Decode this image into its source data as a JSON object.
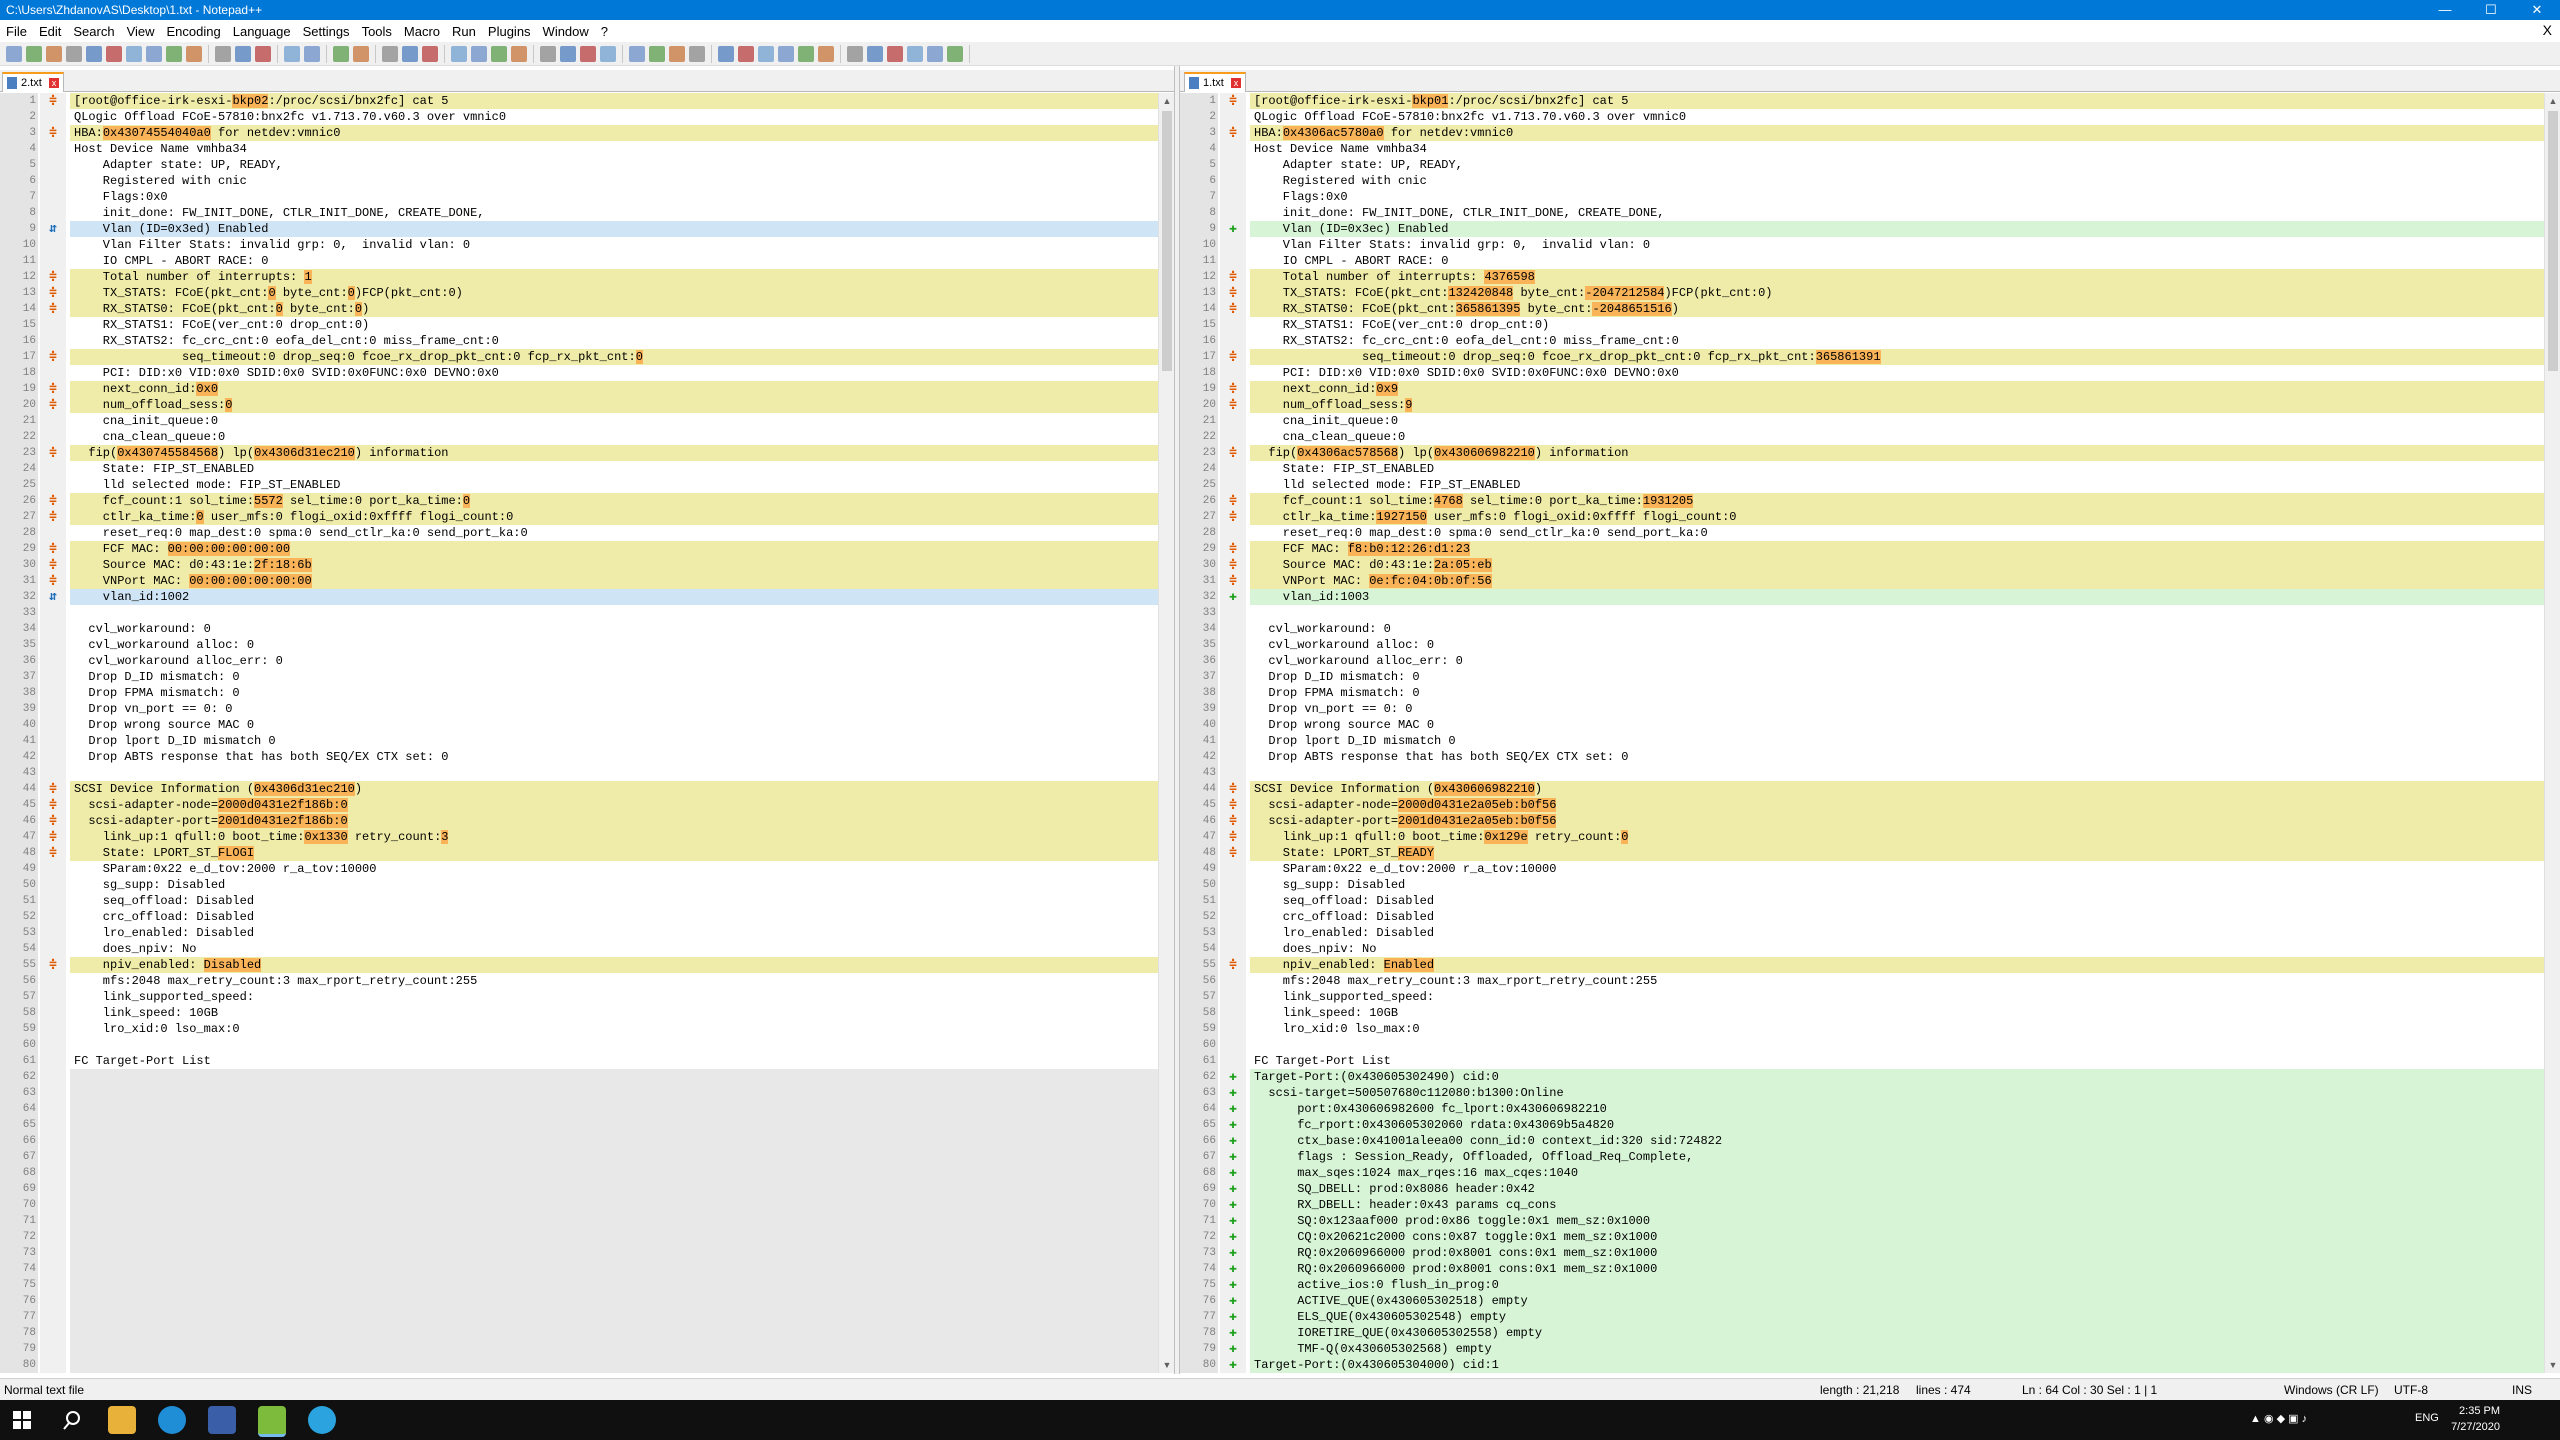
{
  "window": {
    "title": "C:\\Users\\ZhdanovAS\\Desktop\\1.txt - Notepad++",
    "minimize": "—",
    "maximize": "☐",
    "close": "✕"
  },
  "menu": [
    "File",
    "Edit",
    "Search",
    "View",
    "Encoding",
    "Language",
    "Settings",
    "Tools",
    "Macro",
    "Run",
    "Plugins",
    "Window",
    "?"
  ],
  "menu_close": "X",
  "left": {
    "tab": "2.txt",
    "lines": [
      {
        "n": 1,
        "m": "changed",
        "t": "[root@office-irk-esxi-<h>bkp02</h>:/proc/scsi/bnx2fc] cat 5"
      },
      {
        "n": 2,
        "m": "",
        "t": "QLogic Offload FCoE-57810:bnx2fc v1.713.70.v60.3 over vmnic0"
      },
      {
        "n": 3,
        "m": "changed",
        "t": "HBA:<h>0x43074554040a0</h> for netdev:vmnic0"
      },
      {
        "n": 4,
        "m": "",
        "t": "Host Device Name vmhba34"
      },
      {
        "n": 5,
        "m": "",
        "t": "    Adapter state: UP, READY,"
      },
      {
        "n": 6,
        "m": "",
        "t": "    Registered with cnic"
      },
      {
        "n": 7,
        "m": "",
        "t": "    Flags:0x0"
      },
      {
        "n": 8,
        "m": "",
        "t": "    init_done: FW_INIT_DONE, CTLR_INIT_DONE, CREATE_DONE,"
      },
      {
        "n": 9,
        "m": "moved",
        "t": "    Vlan (ID=0x3ed) Enabled"
      },
      {
        "n": 10,
        "m": "",
        "t": "    Vlan Filter Stats: invalid grp: 0,  invalid vlan: 0"
      },
      {
        "n": 11,
        "m": "",
        "t": "    IO CMPL - ABORT RACE: 0"
      },
      {
        "n": 12,
        "m": "changed",
        "t": "    Total number of interrupts: <h>1</h>"
      },
      {
        "n": 13,
        "m": "changed",
        "t": "    TX_STATS: FCoE(pkt_cnt:<h>0</h> byte_cnt:<h>0</h>)FCP(pkt_cnt:0)"
      },
      {
        "n": 14,
        "m": "changed",
        "t": "    RX_STATS0: FCoE(pkt_cnt:<h>0</h> byte_cnt:<h>0</h>)"
      },
      {
        "n": 15,
        "m": "",
        "t": "    RX_STATS1: FCoE(ver_cnt:0 drop_cnt:0)"
      },
      {
        "n": 16,
        "m": "",
        "t": "    RX_STATS2: fc_crc_cnt:0 eofa_del_cnt:0 miss_frame_cnt:0"
      },
      {
        "n": 17,
        "m": "changed",
        "t": "               seq_timeout:0 drop_seq:0 fcoe_rx_drop_pkt_cnt:0 fcp_rx_pkt_cnt:<h>0</h>"
      },
      {
        "n": 18,
        "m": "",
        "t": "    PCI: DID:x0 VID:0x0 SDID:0x0 SVID:0x0FUNC:0x0 DEVNO:0x0"
      },
      {
        "n": 19,
        "m": "changed",
        "t": "    next_conn_id:<h>0x0</h>"
      },
      {
        "n": 20,
        "m": "changed",
        "t": "    num_offload_sess:<h>0</h>"
      },
      {
        "n": 21,
        "m": "",
        "t": "    cna_init_queue:0"
      },
      {
        "n": 22,
        "m": "",
        "t": "    cna_clean_queue:0"
      },
      {
        "n": 23,
        "m": "changed",
        "t": "  fip(<h>0x430745584568</h>) lp(<h>0x4306d31ec210</h>) information"
      },
      {
        "n": 24,
        "m": "",
        "t": "    State: FIP_ST_ENABLED"
      },
      {
        "n": 25,
        "m": "",
        "t": "    lld selected mode: FIP_ST_ENABLED"
      },
      {
        "n": 26,
        "m": "changed",
        "t": "    fcf_count:1 sol_time:<h>5572</h> sel_time:0 port_ka_time:<h>0</h>"
      },
      {
        "n": 27,
        "m": "changed",
        "t": "    ctlr_ka_time:<h>0</h> user_mfs:0 flogi_oxid:0xffff flogi_count:0"
      },
      {
        "n": 28,
        "m": "",
        "t": "    reset_req:0 map_dest:0 spma:0 send_ctlr_ka:0 send_port_ka:0"
      },
      {
        "n": 29,
        "m": "changed",
        "t": "    FCF MAC: <h>00:00:00:00:00:00</h>"
      },
      {
        "n": 30,
        "m": "changed",
        "t": "    Source MAC: d0:43:1e:<h>2f:18:6b</h>"
      },
      {
        "n": 31,
        "m": "changed",
        "t": "    VNPort MAC: <h>00:00:00:00:00:00</h>"
      },
      {
        "n": 32,
        "m": "moved",
        "t": "    vlan_id:1002"
      },
      {
        "n": 33,
        "m": "",
        "t": ""
      },
      {
        "n": 34,
        "m": "",
        "t": "  cvl_workaround: 0"
      },
      {
        "n": 35,
        "m": "",
        "t": "  cvl_workaround alloc: 0"
      },
      {
        "n": 36,
        "m": "",
        "t": "  cvl_workaround alloc_err: 0"
      },
      {
        "n": 37,
        "m": "",
        "t": "  Drop D_ID mismatch: 0"
      },
      {
        "n": 38,
        "m": "",
        "t": "  Drop FPMA mismatch: 0"
      },
      {
        "n": 39,
        "m": "",
        "t": "  Drop vn_port == 0: 0"
      },
      {
        "n": 40,
        "m": "",
        "t": "  Drop wrong source MAC 0"
      },
      {
        "n": 41,
        "m": "",
        "t": "  Drop lport D_ID mismatch 0"
      },
      {
        "n": 42,
        "m": "",
        "t": "  Drop ABTS response that has both SEQ/EX CTX set: 0"
      },
      {
        "n": 43,
        "m": "",
        "t": ""
      },
      {
        "n": 44,
        "m": "changed",
        "t": "SCSI Device Information (<h>0x4306d31ec210</h>)"
      },
      {
        "n": 45,
        "m": "changed",
        "t": "  scsi-adapter-node=<h>2000d0431e2f186b:0</h>"
      },
      {
        "n": 46,
        "m": "changed",
        "t": "  scsi-adapter-port=<h>2001d0431e2f186b:0</h>"
      },
      {
        "n": 47,
        "m": "changed",
        "t": "    link_up:1 qfull:0 boot_time:<h>0x1330</h> retry_count:<h>3</h>"
      },
      {
        "n": 48,
        "m": "changed",
        "t": "    State: LPORT_ST_<h>FLOGI</h>"
      },
      {
        "n": 49,
        "m": "",
        "t": "    SParam:0x22 e_d_tov:2000 r_a_tov:10000"
      },
      {
        "n": 50,
        "m": "",
        "t": "    sg_supp: Disabled"
      },
      {
        "n": 51,
        "m": "",
        "t": "    seq_offload: Disabled"
      },
      {
        "n": 52,
        "m": "",
        "t": "    crc_offload: Disabled"
      },
      {
        "n": 53,
        "m": "",
        "t": "    lro_enabled: Disabled"
      },
      {
        "n": 54,
        "m": "",
        "t": "    does_npiv: No"
      },
      {
        "n": 55,
        "m": "changed",
        "t": "    npiv_enabled: <h>Disabled</h>"
      },
      {
        "n": 56,
        "m": "",
        "t": "    mfs:2048 max_retry_count:3 max_rport_retry_count:255"
      },
      {
        "n": 57,
        "m": "",
        "t": "    link_supported_speed:"
      },
      {
        "n": 58,
        "m": "",
        "t": "    link_speed: 10GB"
      },
      {
        "n": 59,
        "m": "",
        "t": "    lro_xid:0 lso_max:0"
      },
      {
        "n": 60,
        "m": "",
        "t": ""
      },
      {
        "n": 61,
        "m": "",
        "t": "FC Target-Port List"
      },
      {
        "n": 62,
        "m": "blank",
        "t": ""
      },
      {
        "n": 63,
        "m": "blank",
        "t": ""
      },
      {
        "n": 64,
        "m": "blank",
        "t": ""
      },
      {
        "n": 65,
        "m": "blank",
        "t": ""
      },
      {
        "n": 66,
        "m": "blank",
        "t": ""
      },
      {
        "n": 67,
        "m": "blank",
        "t": ""
      },
      {
        "n": 68,
        "m": "blank",
        "t": ""
      },
      {
        "n": 69,
        "m": "blank",
        "t": ""
      },
      {
        "n": 70,
        "m": "blank",
        "t": ""
      },
      {
        "n": 71,
        "m": "blank",
        "t": ""
      },
      {
        "n": 72,
        "m": "blank",
        "t": ""
      },
      {
        "n": 73,
        "m": "blank",
        "t": ""
      },
      {
        "n": 74,
        "m": "blank",
        "t": ""
      },
      {
        "n": 75,
        "m": "blank",
        "t": ""
      },
      {
        "n": 76,
        "m": "blank",
        "t": ""
      },
      {
        "n": 77,
        "m": "blank",
        "t": ""
      },
      {
        "n": 78,
        "m": "blank",
        "t": ""
      },
      {
        "n": 79,
        "m": "blank",
        "t": ""
      },
      {
        "n": 80,
        "m": "blank",
        "t": ""
      }
    ]
  },
  "right": {
    "tab": "1.txt",
    "lines": [
      {
        "n": 1,
        "m": "changed",
        "t": "[root@office-irk-esxi-<h>bkp01</h>:/proc/scsi/bnx2fc] cat 5"
      },
      {
        "n": 2,
        "m": "",
        "t": "QLogic Offload FCoE-57810:bnx2fc v1.713.70.v60.3 over vmnic0"
      },
      {
        "n": 3,
        "m": "changed",
        "t": "HBA:<h>0x4306ac5780a0</h> for netdev:vmnic0"
      },
      {
        "n": 4,
        "m": "",
        "t": "Host Device Name vmhba34"
      },
      {
        "n": 5,
        "m": "",
        "t": "    Adapter state: UP, READY,"
      },
      {
        "n": 6,
        "m": "",
        "t": "    Registered with cnic"
      },
      {
        "n": 7,
        "m": "",
        "t": "    Flags:0x0"
      },
      {
        "n": 8,
        "m": "",
        "t": "    init_done: FW_INIT_DONE, CTLR_INIT_DONE, CREATE_DONE,"
      },
      {
        "n": 9,
        "m": "added",
        "t": "    Vlan (ID=0x3ec) Enabled"
      },
      {
        "n": 10,
        "m": "",
        "t": "    Vlan Filter Stats: invalid grp: 0,  invalid vlan: 0"
      },
      {
        "n": 11,
        "m": "",
        "t": "    IO CMPL - ABORT RACE: 0"
      },
      {
        "n": 12,
        "m": "changed",
        "t": "    Total number of interrupts: <h>4376598</h>"
      },
      {
        "n": 13,
        "m": "changed",
        "t": "    TX_STATS: FCoE(pkt_cnt:<h>132420848</h> byte_cnt:<h>-2047212584</h>)FCP(pkt_cnt:0)"
      },
      {
        "n": 14,
        "m": "changed",
        "t": "    RX_STATS0: FCoE(pkt_cnt:<h>365861395</h> byte_cnt:<h>-2048651516</h>)"
      },
      {
        "n": 15,
        "m": "",
        "t": "    RX_STATS1: FCoE(ver_cnt:0 drop_cnt:0)"
      },
      {
        "n": 16,
        "m": "",
        "t": "    RX_STATS2: fc_crc_cnt:0 eofa_del_cnt:0 miss_frame_cnt:0"
      },
      {
        "n": 17,
        "m": "changed",
        "t": "               seq_timeout:0 drop_seq:0 fcoe_rx_drop_pkt_cnt:0 fcp_rx_pkt_cnt:<h>365861391</h>"
      },
      {
        "n": 18,
        "m": "",
        "t": "    PCI: DID:x0 VID:0x0 SDID:0x0 SVID:0x0FUNC:0x0 DEVNO:0x0"
      },
      {
        "n": 19,
        "m": "changed",
        "t": "    next_conn_id:<h>0x9</h>"
      },
      {
        "n": 20,
        "m": "changed",
        "t": "    num_offload_sess:<h>9</h>"
      },
      {
        "n": 21,
        "m": "",
        "t": "    cna_init_queue:0"
      },
      {
        "n": 22,
        "m": "",
        "t": "    cna_clean_queue:0"
      },
      {
        "n": 23,
        "m": "changed",
        "t": "  fip(<h>0x4306ac578568</h>) lp(<h>0x430606982210</h>) information"
      },
      {
        "n": 24,
        "m": "",
        "t": "    State: FIP_ST_ENABLED"
      },
      {
        "n": 25,
        "m": "",
        "t": "    lld selected mode: FIP_ST_ENABLED"
      },
      {
        "n": 26,
        "m": "changed",
        "t": "    fcf_count:1 sol_time:<h>4768</h> sel_time:0 port_ka_time:<h>1931205</h>"
      },
      {
        "n": 27,
        "m": "changed",
        "t": "    ctlr_ka_time:<h>1927150</h> user_mfs:0 flogi_oxid:0xffff flogi_count:0"
      },
      {
        "n": 28,
        "m": "",
        "t": "    reset_req:0 map_dest:0 spma:0 send_ctlr_ka:0 send_port_ka:0"
      },
      {
        "n": 29,
        "m": "changed",
        "t": "    FCF MAC: <h>f8:b0:12:26:d1:23</h>"
      },
      {
        "n": 30,
        "m": "changed",
        "t": "    Source MAC: d0:43:1e:<h>2a:05:eb</h>"
      },
      {
        "n": 31,
        "m": "changed",
        "t": "    VNPort MAC: <h>0e:fc:04:0b:0f:56</h>"
      },
      {
        "n": 32,
        "m": "added",
        "t": "    vlan_id:1003"
      },
      {
        "n": 33,
        "m": "",
        "t": ""
      },
      {
        "n": 34,
        "m": "",
        "t": "  cvl_workaround: 0"
      },
      {
        "n": 35,
        "m": "",
        "t": "  cvl_workaround alloc: 0"
      },
      {
        "n": 36,
        "m": "",
        "t": "  cvl_workaround alloc_err: 0"
      },
      {
        "n": 37,
        "m": "",
        "t": "  Drop D_ID mismatch: 0"
      },
      {
        "n": 38,
        "m": "",
        "t": "  Drop FPMA mismatch: 0"
      },
      {
        "n": 39,
        "m": "",
        "t": "  Drop vn_port == 0: 0"
      },
      {
        "n": 40,
        "m": "",
        "t": "  Drop wrong source MAC 0"
      },
      {
        "n": 41,
        "m": "",
        "t": "  Drop lport D_ID mismatch 0"
      },
      {
        "n": 42,
        "m": "",
        "t": "  Drop ABTS response that has both SEQ/EX CTX set: 0"
      },
      {
        "n": 43,
        "m": "",
        "t": ""
      },
      {
        "n": 44,
        "m": "changed",
        "t": "SCSI Device Information (<h>0x430606982210</h>)"
      },
      {
        "n": 45,
        "m": "changed",
        "t": "  scsi-adapter-node=<h>2000d0431e2a05eb:b0f56</h>"
      },
      {
        "n": 46,
        "m": "changed",
        "t": "  scsi-adapter-port=<h>2001d0431e2a05eb:b0f56</h>"
      },
      {
        "n": 47,
        "m": "changed",
        "t": "    link_up:1 qfull:0 boot_time:<h>0x129e</h> retry_count:<h>0</h>"
      },
      {
        "n": 48,
        "m": "changed",
        "t": "    State: LPORT_ST_<h>READY</h>"
      },
      {
        "n": 49,
        "m": "",
        "t": "    SParam:0x22 e_d_tov:2000 r_a_tov:10000"
      },
      {
        "n": 50,
        "m": "",
        "t": "    sg_supp: Disabled"
      },
      {
        "n": 51,
        "m": "",
        "t": "    seq_offload: Disabled"
      },
      {
        "n": 52,
        "m": "",
        "t": "    crc_offload: Disabled"
      },
      {
        "n": 53,
        "m": "",
        "t": "    lro_enabled: Disabled"
      },
      {
        "n": 54,
        "m": "",
        "t": "    does_npiv: No"
      },
      {
        "n": 55,
        "m": "changed",
        "t": "    npiv_enabled: <h>Enabled</h>"
      },
      {
        "n": 56,
        "m": "",
        "t": "    mfs:2048 max_retry_count:3 max_rport_retry_count:255"
      },
      {
        "n": 57,
        "m": "",
        "t": "    link_supported_speed:"
      },
      {
        "n": 58,
        "m": "",
        "t": "    link_speed: 10GB"
      },
      {
        "n": 59,
        "m": "",
        "t": "    lro_xid:0 lso_max:0"
      },
      {
        "n": 60,
        "m": "",
        "t": ""
      },
      {
        "n": 61,
        "m": "",
        "t": "FC Target-Port List"
      },
      {
        "n": 62,
        "m": "added",
        "t": "Target-Port:(0x430605302490) cid:0"
      },
      {
        "n": 63,
        "m": "added",
        "t": "  scsi-target=500507680c112080:b1300:Online"
      },
      {
        "n": 64,
        "m": "added",
        "t": "      port:0x430606982600 fc_lport:0x430606982210"
      },
      {
        "n": 65,
        "m": "added",
        "t": "      fc_rport:0x430605302060 rdata:0x43069b5a4820"
      },
      {
        "n": 66,
        "m": "added",
        "t": "      ctx_base:0x41001aleea00 conn_id:0 context_id:320 sid:724822"
      },
      {
        "n": 67,
        "m": "added",
        "t": "      flags : Session_Ready, Offloaded, Offload_Req_Complete,"
      },
      {
        "n": 68,
        "m": "added",
        "t": "      max_sqes:1024 max_rqes:16 max_cqes:1040"
      },
      {
        "n": 69,
        "m": "added",
        "t": "      SQ_DBELL: prod:0x8086 header:0x42"
      },
      {
        "n": 70,
        "m": "added",
        "t": "      RX_DBELL: header:0x43 params cq_cons"
      },
      {
        "n": 71,
        "m": "added",
        "t": "      SQ:0x123aaf000 prod:0x86 toggle:0x1 mem_sz:0x1000"
      },
      {
        "n": 72,
        "m": "added",
        "t": "      CQ:0x20621c2000 cons:0x87 toggle:0x1 mem_sz:0x1000"
      },
      {
        "n": 73,
        "m": "added",
        "t": "      RQ:0x2060966000 prod:0x8001 cons:0x1 mem_sz:0x1000"
      },
      {
        "n": 74,
        "m": "added",
        "t": "      RQ:0x2060966000 prod:0x8001 cons:0x1 mem_sz:0x1000"
      },
      {
        "n": 75,
        "m": "added",
        "t": "      active_ios:0 flush_in_prog:0"
      },
      {
        "n": 76,
        "m": "added",
        "t": "      ACTIVE_QUE(0x430605302518) empty"
      },
      {
        "n": 77,
        "m": "added",
        "t": "      ELS_QUE(0x430605302548) empty"
      },
      {
        "n": 78,
        "m": "added",
        "t": "      IORETIRE_QUE(0x430605302558) empty"
      },
      {
        "n": 79,
        "m": "added",
        "t": "      TMF-Q(0x430605302568) empty"
      },
      {
        "n": 80,
        "m": "added",
        "t": "Target-Port:(0x430605304000) cid:1"
      }
    ]
  },
  "status": {
    "filetype": "Normal text file",
    "length": "length : 21,218",
    "lines": "lines : 474",
    "position": "Ln : 64    Col : 30    Sel : 1 | 1",
    "eol": "Windows (CR LF)",
    "encoding": "UTF-8",
    "mode": "INS"
  },
  "taskbar": {
    "lang": "ENG",
    "time": "2:35 PM",
    "date": "7/27/2020"
  },
  "colors": {
    "changed": "#efeba8",
    "moved": "#cfe4f5",
    "added": "#d7f5d6",
    "highlight": "#f9b45a",
    "titlebar": "#0078d7"
  },
  "icons": {
    "changed": "diff-changed-icon",
    "moved": "diff-moved-icon",
    "added": "diff-added-icon"
  }
}
